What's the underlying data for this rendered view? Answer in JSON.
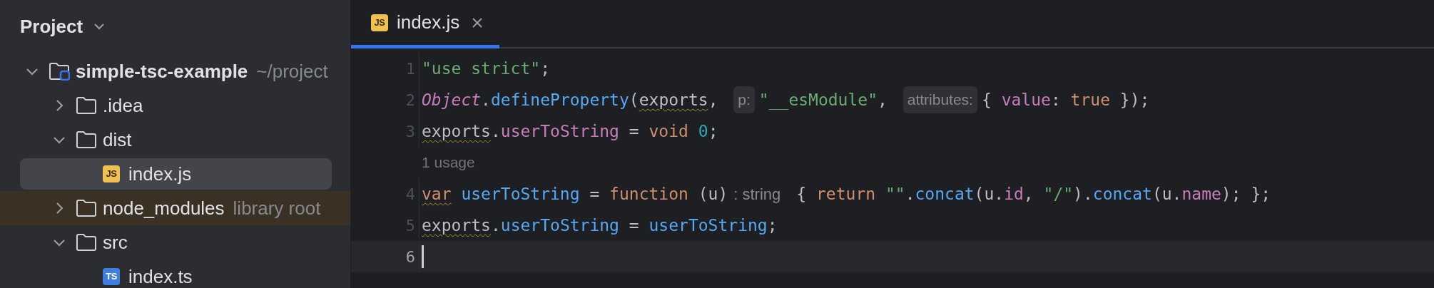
{
  "sidebar": {
    "title": "Project",
    "tree": [
      {
        "label": "simple-tsc-example",
        "kind": "project",
        "suffix": "~/project",
        "expanded": true,
        "selected": false,
        "highlighted": false,
        "children": [
          {
            "label": ".idea",
            "kind": "folder",
            "expanded": false,
            "selected": false,
            "highlighted": false
          },
          {
            "label": "dist",
            "kind": "folder",
            "expanded": true,
            "selected": false,
            "highlighted": false,
            "children": [
              {
                "label": "index.js",
                "kind": "js",
                "badge": "JS",
                "selected": true,
                "highlighted": false
              }
            ]
          },
          {
            "label": "node_modules",
            "kind": "folder",
            "suffix": "library root",
            "expanded": false,
            "selected": false,
            "highlighted": true
          },
          {
            "label": "src",
            "kind": "folder",
            "expanded": true,
            "selected": false,
            "highlighted": false,
            "children": [
              {
                "label": "index.ts",
                "kind": "ts",
                "badge": "TS",
                "selected": false,
                "highlighted": false
              }
            ]
          }
        ]
      }
    ]
  },
  "tabs": [
    {
      "label": "index.js",
      "badge": "JS",
      "kind": "js",
      "selected": true
    }
  ],
  "editor": {
    "lines": [
      {
        "number": "1",
        "current": false,
        "segments": [
          {
            "kind": "code",
            "tokens": [
              {
                "text": "\"use strict\"",
                "kind": "string",
                "warning": false
              },
              {
                "text": ";",
                "kind": "plain",
                "warning": false
              }
            ]
          }
        ]
      },
      {
        "number": "2",
        "current": false,
        "segments": [
          {
            "kind": "code",
            "tokens": [
              {
                "text": "Object",
                "kind": "class",
                "warning": false
              },
              {
                "text": ".",
                "kind": "plain",
                "warning": false
              },
              {
                "text": "defineProperty",
                "kind": "method",
                "warning": false
              },
              {
                "text": "(",
                "kind": "plain",
                "warning": false
              },
              {
                "text": "exports",
                "kind": "plain",
                "warning": true
              },
              {
                "text": ", ",
                "kind": "plain",
                "warning": false
              }
            ]
          },
          {
            "kind": "param-hint",
            "text": "p:"
          },
          {
            "kind": "code",
            "tokens": [
              {
                "text": "\"__esModule\"",
                "kind": "string",
                "warning": false
              },
              {
                "text": ", ",
                "kind": "plain",
                "warning": false
              }
            ]
          },
          {
            "kind": "param-hint",
            "text": "attributes:"
          },
          {
            "kind": "code",
            "tokens": [
              {
                "text": "{ ",
                "kind": "plain",
                "warning": false
              },
              {
                "text": "value",
                "kind": "property",
                "warning": false
              },
              {
                "text": ": ",
                "kind": "plain",
                "warning": false
              },
              {
                "text": "true",
                "kind": "keyword",
                "warning": false
              },
              {
                "text": " });",
                "kind": "plain",
                "warning": false
              }
            ]
          }
        ]
      },
      {
        "number": "3",
        "current": false,
        "segments": [
          {
            "kind": "code",
            "tokens": [
              {
                "text": "exports",
                "kind": "plain",
                "warning": true
              },
              {
                "text": ".",
                "kind": "plain",
                "warning": false
              },
              {
                "text": "userToString",
                "kind": "property",
                "warning": false
              },
              {
                "text": " = ",
                "kind": "plain",
                "warning": false
              },
              {
                "text": "void ",
                "kind": "keyword",
                "warning": false
              },
              {
                "text": "0",
                "kind": "number",
                "warning": false
              },
              {
                "text": ";",
                "kind": "plain",
                "warning": false
              }
            ]
          }
        ]
      },
      {
        "number": "4",
        "current": false,
        "usage_hint": "1 usage",
        "segments": [
          {
            "kind": "code",
            "tokens": [
              {
                "text": "var",
                "kind": "keyword",
                "warning": true
              },
              {
                "text": " userToString",
                "kind": "method",
                "warning": false
              },
              {
                "text": " = ",
                "kind": "plain",
                "warning": false
              },
              {
                "text": "function",
                "kind": "keyword",
                "warning": false
              },
              {
                "text": " (u)",
                "kind": "plain",
                "warning": false
              }
            ]
          },
          {
            "kind": "type-hint",
            "text": ": string"
          },
          {
            "kind": "code",
            "tokens": [
              {
                "text": "{ ",
                "kind": "plain",
                "warning": false
              },
              {
                "text": "return ",
                "kind": "keyword",
                "warning": false
              },
              {
                "text": "\"\"",
                "kind": "string",
                "warning": false
              },
              {
                "text": ".",
                "kind": "plain",
                "warning": false
              },
              {
                "text": "concat",
                "kind": "method",
                "warning": false
              },
              {
                "text": "(u.",
                "kind": "plain",
                "warning": false
              },
              {
                "text": "id",
                "kind": "property",
                "warning": false
              },
              {
                "text": ", ",
                "kind": "plain",
                "warning": false
              },
              {
                "text": "\"/\"",
                "kind": "string",
                "warning": false
              },
              {
                "text": ").",
                "kind": "plain",
                "warning": false
              },
              {
                "text": "concat",
                "kind": "method",
                "warning": false
              },
              {
                "text": "(u.",
                "kind": "plain",
                "warning": false
              },
              {
                "text": "name",
                "kind": "property",
                "warning": false
              },
              {
                "text": "); };",
                "kind": "plain",
                "warning": false
              }
            ]
          }
        ]
      },
      {
        "number": "5",
        "current": false,
        "segments": [
          {
            "kind": "code",
            "tokens": [
              {
                "text": "exports",
                "kind": "plain",
                "warning": true
              },
              {
                "text": ".",
                "kind": "plain",
                "warning": false
              },
              {
                "text": "userToString",
                "kind": "method",
                "warning": false
              },
              {
                "text": " = ",
                "kind": "plain",
                "warning": false
              },
              {
                "text": "userToString",
                "kind": "method",
                "warning": false
              },
              {
                "text": ";",
                "kind": "plain",
                "warning": false
              }
            ]
          }
        ]
      },
      {
        "number": "6",
        "current": true
      }
    ]
  }
}
